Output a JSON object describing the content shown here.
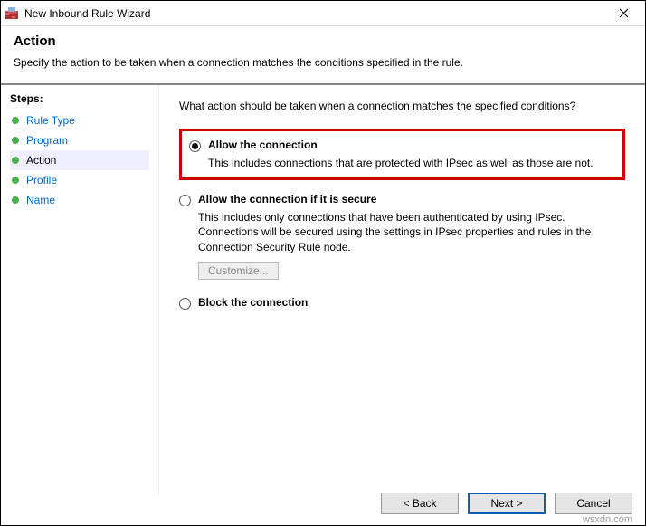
{
  "titlebar": {
    "title": "New Inbound Rule Wizard"
  },
  "header": {
    "title": "Action",
    "description": "Specify the action to be taken when a connection matches the conditions specified in the rule."
  },
  "steps": {
    "label": "Steps:",
    "items": [
      {
        "label": "Rule Type",
        "current": false
      },
      {
        "label": "Program",
        "current": false
      },
      {
        "label": "Action",
        "current": true
      },
      {
        "label": "Profile",
        "current": false
      },
      {
        "label": "Name",
        "current": false
      }
    ]
  },
  "content": {
    "question": "What action should be taken when a connection matches the specified conditions?",
    "options": {
      "allow": {
        "label": "Allow the connection",
        "desc": "This includes connections that are protected with IPsec as well as those are not."
      },
      "secure": {
        "label": "Allow the connection if it is secure",
        "desc": "This includes only connections that have been authenticated by using IPsec. Connections will be secured using the settings in IPsec properties and rules in the Connection Security Rule node.",
        "customize": "Customize..."
      },
      "block": {
        "label": "Block the connection"
      }
    }
  },
  "footer": {
    "back": "< Back",
    "next": "Next >",
    "cancel": "Cancel"
  },
  "watermark": "wsxdn.com"
}
